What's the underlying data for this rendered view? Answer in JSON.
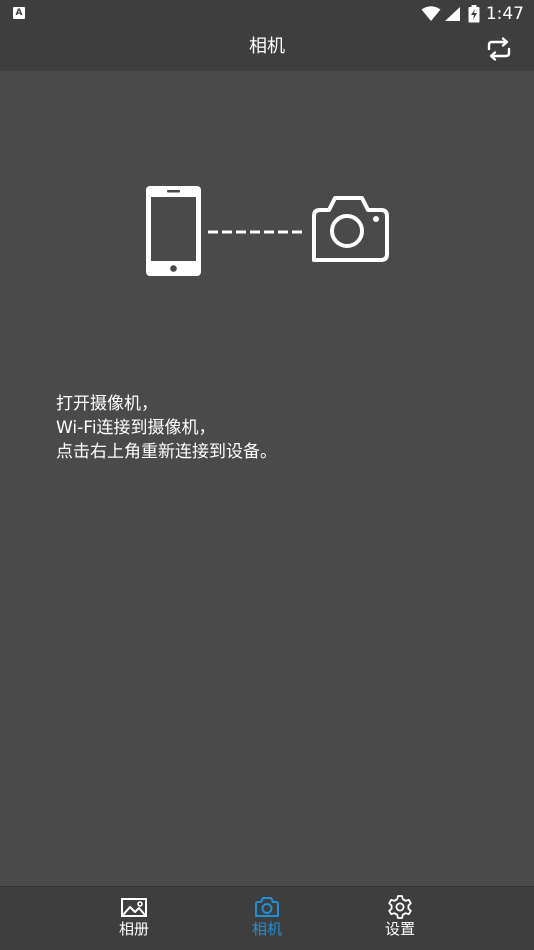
{
  "status_bar": {
    "left_icon_glyph": "A",
    "time": "1:47",
    "icons": [
      "wifi-icon",
      "signal-icon",
      "battery-charging-icon"
    ]
  },
  "header": {
    "title": "相机",
    "action_icon": "switch-icon"
  },
  "illustration": {
    "icons": [
      "phone-icon",
      "dashed-connector",
      "camera-icon"
    ]
  },
  "instructions": {
    "line1": "打开摄像机，",
    "line2": "Wi-Fi连接到摄像机，",
    "line3": "点击右上角重新连接到设备。"
  },
  "bottom_nav": {
    "items": [
      {
        "label": "相册",
        "icon": "gallery-icon",
        "active": false
      },
      {
        "label": "相机",
        "icon": "camera-icon",
        "active": true
      },
      {
        "label": "设置",
        "icon": "gear-icon",
        "active": false
      }
    ]
  },
  "colors": {
    "background": "#4a4a4a",
    "bar": "#3e3e3e",
    "accent": "#1f8fd6",
    "foreground": "#ffffff"
  }
}
